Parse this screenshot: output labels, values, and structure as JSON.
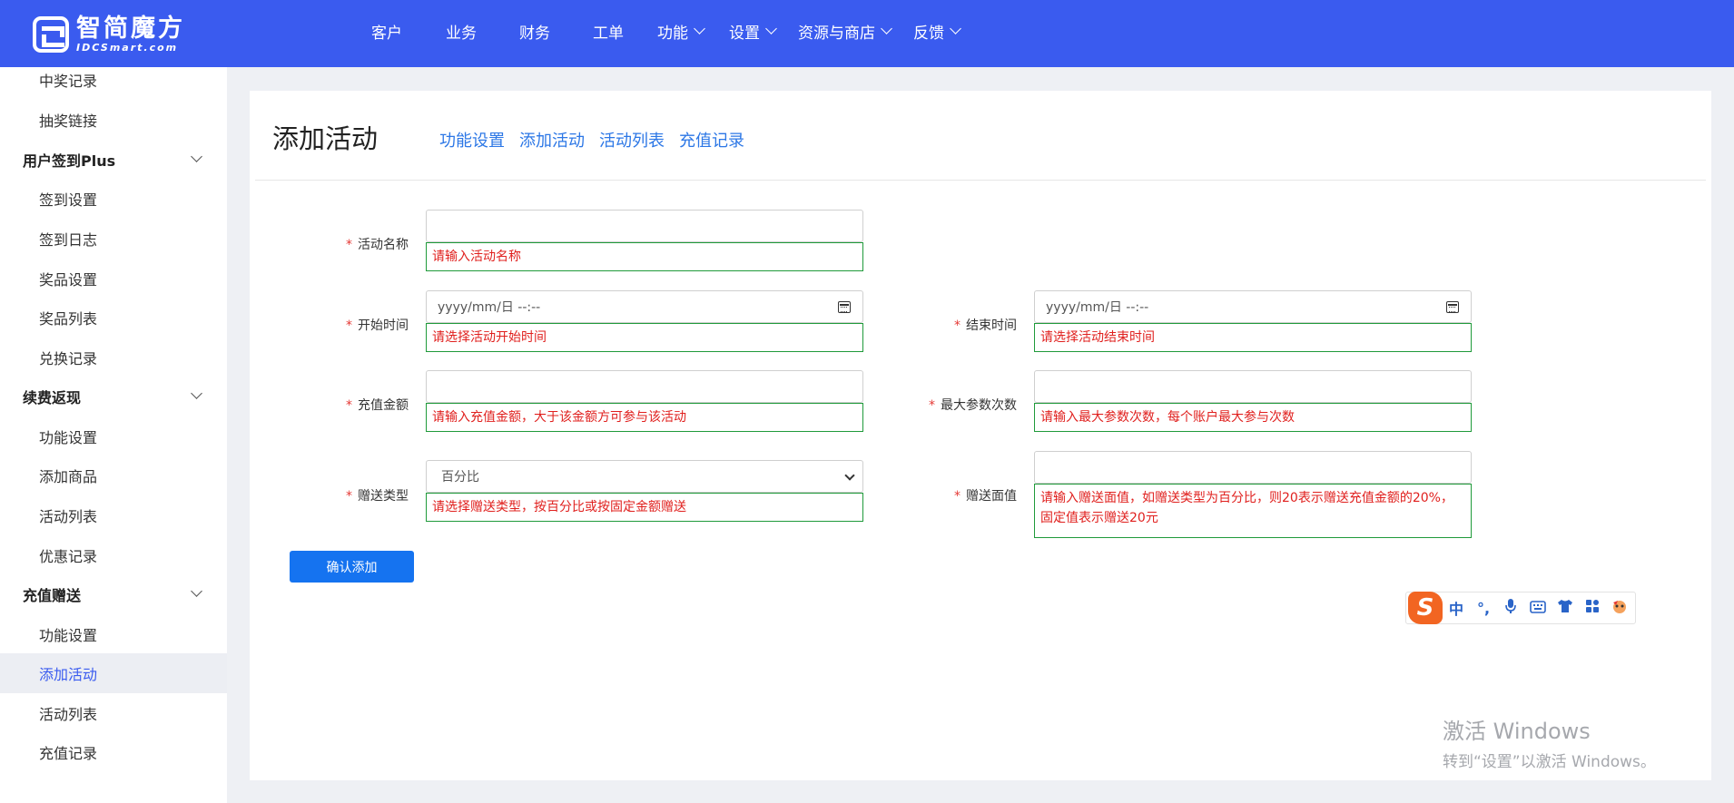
{
  "brand": {
    "name_cn": "智简魔方",
    "name_en": "IDCSmart.com"
  },
  "nav": [
    {
      "label": "客户",
      "has_dropdown": false
    },
    {
      "label": "业务",
      "has_dropdown": false
    },
    {
      "label": "财务",
      "has_dropdown": false
    },
    {
      "label": "工单",
      "has_dropdown": false
    },
    {
      "label": "功能",
      "has_dropdown": true
    },
    {
      "label": "设置",
      "has_dropdown": true
    },
    {
      "label": "资源与商店",
      "has_dropdown": true
    },
    {
      "label": "反馈",
      "has_dropdown": true
    }
  ],
  "sidebar": {
    "items": [
      {
        "label": "中奖记录",
        "type": "sub"
      },
      {
        "label": "抽奖链接",
        "type": "sub"
      },
      {
        "label": "用户签到Plus",
        "type": "group"
      },
      {
        "label": "签到设置",
        "type": "sub"
      },
      {
        "label": "签到日志",
        "type": "sub"
      },
      {
        "label": "奖品设置",
        "type": "sub"
      },
      {
        "label": "奖品列表",
        "type": "sub"
      },
      {
        "label": "兑换记录",
        "type": "sub"
      },
      {
        "label": "续费返现",
        "type": "group"
      },
      {
        "label": "功能设置",
        "type": "sub"
      },
      {
        "label": "添加商品",
        "type": "sub"
      },
      {
        "label": "活动列表",
        "type": "sub"
      },
      {
        "label": "优惠记录",
        "type": "sub"
      },
      {
        "label": "充值赠送",
        "type": "group"
      },
      {
        "label": "功能设置",
        "type": "sub"
      },
      {
        "label": "添加活动",
        "type": "sub",
        "active": true
      },
      {
        "label": "活动列表",
        "type": "sub"
      },
      {
        "label": "充值记录",
        "type": "sub"
      }
    ]
  },
  "page": {
    "title": "添加活动",
    "tabs": [
      "功能设置",
      "添加活动",
      "活动列表",
      "充值记录"
    ]
  },
  "form": {
    "required_mark": "*",
    "activity_name": {
      "label": "活动名称",
      "value": "",
      "error": "请输入活动名称"
    },
    "start_time": {
      "label": "开始时间",
      "placeholder": "yyyy/mm/日 --:--",
      "error": "请选择活动开始时间"
    },
    "end_time": {
      "label": "结束时间",
      "placeholder": "yyyy/mm/日 --:--",
      "error": "请选择活动结束时间"
    },
    "recharge_amount": {
      "label": "充值金额",
      "value": "",
      "error": "请输入充值金额，大于该金额方可参与该活动"
    },
    "max_participation": {
      "label": "最大参数次数",
      "value": "",
      "error": "请输入最大参数次数，每个账户最大参与次数"
    },
    "gift_type": {
      "label": "赠送类型",
      "selected": "百分比",
      "error": "请选择赠送类型，按百分比或按固定金额赠送"
    },
    "gift_value": {
      "label": "赠送面值",
      "value": "",
      "error": "请输入赠送面值，如赠送类型为百分比，则20表示赠送充值金额的20%，固定值表示赠送20元"
    },
    "submit_label": "确认添加"
  },
  "ime": {
    "logo": "S",
    "mode": "中",
    "punct": "°,"
  },
  "watermark": {
    "line1": "激活 Windows",
    "line2": "转到“设置”以激活 Windows。"
  }
}
